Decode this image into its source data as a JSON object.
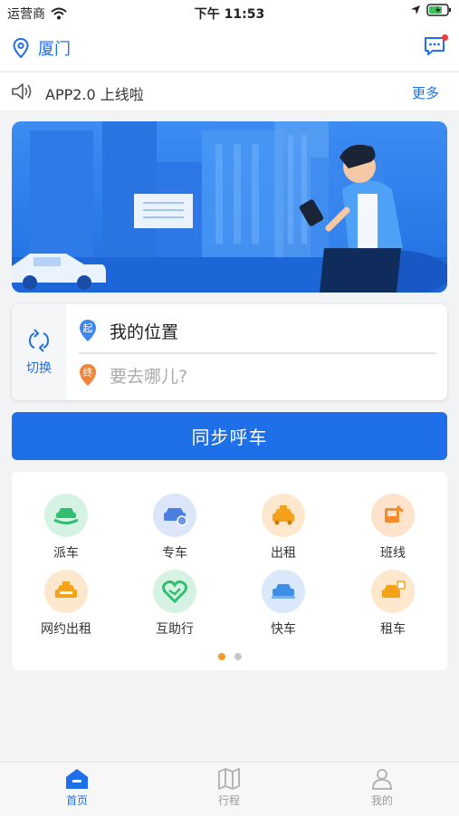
{
  "status_bar": {
    "carrier": "运营商",
    "time": "下午 11:53"
  },
  "header": {
    "city": "厦门"
  },
  "notice": {
    "text": "APP2.0 上线啦",
    "more": "更多"
  },
  "route": {
    "switch_label": "切换",
    "start_badge": "起",
    "start_text": "我的位置",
    "end_badge": "终",
    "end_placeholder": "要去哪儿?"
  },
  "call_button": {
    "label": "同步呼车"
  },
  "services": {
    "items": [
      {
        "label": "派车",
        "color": "#2fbf71"
      },
      {
        "label": "专车",
        "color": "#4a7fe0"
      },
      {
        "label": "出租",
        "color": "#f5a21b"
      },
      {
        "label": "班线",
        "color": "#f28b2c"
      },
      {
        "label": "网约出租",
        "color": "#f5a21b"
      },
      {
        "label": "互助行",
        "color": "#2fbf71"
      },
      {
        "label": "快车",
        "color": "#3d8ee6"
      },
      {
        "label": "租车",
        "color": "#f5a21b"
      }
    ],
    "page": 1,
    "pages": 2
  },
  "tabbar": {
    "items": [
      {
        "label": "首页",
        "active": true
      },
      {
        "label": "行程",
        "active": false
      },
      {
        "label": "我的",
        "active": false
      }
    ]
  },
  "colors": {
    "accent": "#1e6fe8",
    "badge": "#f23b3b",
    "pager_active": "#f39a2a"
  }
}
